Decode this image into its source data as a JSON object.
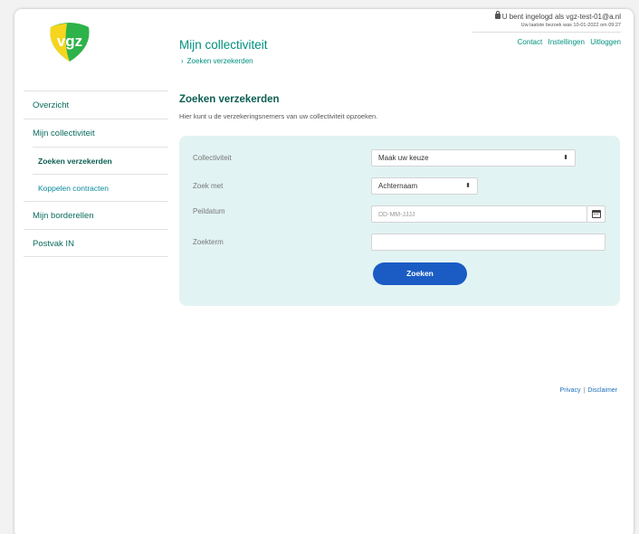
{
  "brand": {
    "logo_text": "vgz",
    "accent": "#00917f",
    "logo_yellow": "#f5d51e",
    "logo_green": "#2db34a"
  },
  "header": {
    "user_line": "U bent ingelogd als vgz-test-01@a.nl",
    "last_visit": "Uw laatste bezoek was 10-01-2022 om 09:27",
    "links": [
      "Contact",
      "Instellingen",
      "Uitloggen"
    ],
    "page_title": "Mijn collectiviteit",
    "breadcrumb": "Zoeken verzekerden"
  },
  "sidebar": {
    "items": [
      {
        "label": "Overzicht"
      },
      {
        "label": "Mijn collectiviteit"
      },
      {
        "label": "Zoeken verzekerden"
      },
      {
        "label": "Koppelen contracten"
      },
      {
        "label": "Mijn borderellen"
      },
      {
        "label": "Postvak IN"
      }
    ]
  },
  "main": {
    "title": "Zoeken verzekerden",
    "intro": "Hier kunt u de verzekeringsnemers van uw collectiviteit opzoeken.",
    "form": {
      "collectiviteit_label": "Collectiviteit",
      "collectiviteit_value": "Maak uw keuze",
      "zoekmet_label": "Zoek met",
      "zoekmet_value": "Achternaam",
      "peildatum_label": "Peildatum",
      "peildatum_placeholder": "DD-MM-JJJJ",
      "zoekterm_label": "Zoekterm",
      "zoekterm_value": "",
      "submit_label": "Zoeken"
    }
  },
  "footer": {
    "privacy": "Privacy",
    "separator": "|",
    "disclaimer": "Disclaimer"
  }
}
